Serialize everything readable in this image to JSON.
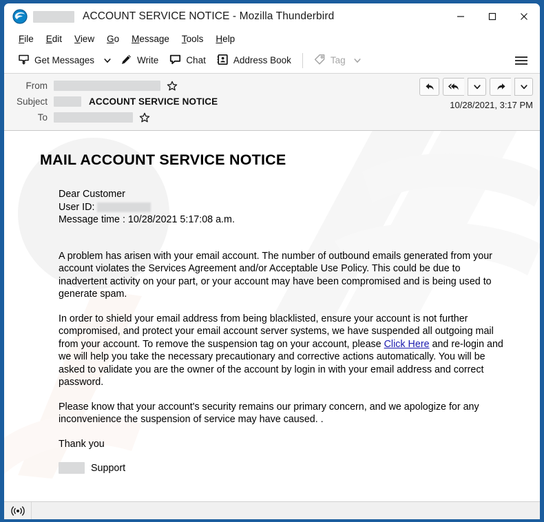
{
  "window": {
    "title": "ACCOUNT SERVICE NOTICE - Mozilla Thunderbird",
    "logo_icon": "thunderbird-logo",
    "minimize_icon": "minimize-icon",
    "maximize_icon": "maximize-icon",
    "close_icon": "close-icon",
    "border_color": "#1b5d9e"
  },
  "menubar": {
    "items": [
      {
        "label": "File",
        "accel": "F",
        "rest": "ile"
      },
      {
        "label": "Edit",
        "accel": "E",
        "rest": "dit"
      },
      {
        "label": "View",
        "accel": "V",
        "rest": "iew"
      },
      {
        "label": "Go",
        "accel": "G",
        "rest": "o"
      },
      {
        "label": "Message",
        "accel": "M",
        "rest": "essage"
      },
      {
        "label": "Tools",
        "accel": "T",
        "rest": "ools"
      },
      {
        "label": "Help",
        "accel": "H",
        "rest": "elp"
      }
    ]
  },
  "toolbar": {
    "get_messages_label": "Get Messages",
    "get_messages_icon": "get-messages-icon",
    "get_messages_caret_icon": "chevron-down-icon",
    "write_label": "Write",
    "write_icon": "pencil-icon",
    "chat_label": "Chat",
    "chat_icon": "speech-bubble-icon",
    "address_book_label": "Address Book",
    "address_book_icon": "address-book-icon",
    "tag_label": "Tag",
    "tag_icon": "tag-icon",
    "tag_caret_icon": "chevron-down-icon",
    "tag_disabled": true,
    "menu_icon": "hamburger-menu-icon"
  },
  "headers": {
    "from_label": "From",
    "from_value": "",
    "from_star_icon": "star-icon",
    "subject_label": "Subject",
    "subject_prefix_redacted": "",
    "subject_value": "ACCOUNT SERVICE NOTICE",
    "to_label": "To",
    "to_value": "",
    "to_star_icon": "star-icon",
    "date": "10/28/2021, 3:17 PM",
    "actions": {
      "reply_icon": "reply-icon",
      "reply_all_icon": "reply-all-icon",
      "reply_all_caret_icon": "chevron-down-icon",
      "forward_icon": "forward-icon",
      "forward_caret_icon": "chevron-down-icon"
    }
  },
  "message": {
    "title": "MAIL ACCOUNT SERVICE NOTICE",
    "greeting": "Dear Customer",
    "user_id_label": "User ID:",
    "user_id_value": "",
    "message_time": "Message time : 10/28/2021 5:17:08 a.m.",
    "paragraph_1": "A problem has arisen with your email account. The number of outbound emails generated from your account violates the  Services Agreement and/or Acceptable Use Policy. This could be due to inadvertent activity on your part, or your account may have been compromised and is being used to generate spam.",
    "paragraph_2_before_link": "In order to shield your email address from being blacklisted, ensure your account is not further compromised, and protect your email account server systems, we have suspended all outgoing mail from your account. To remove the suspension tag on your account, please ",
    "link_text": "Click Here",
    "paragraph_2_after_link": " and re-login and we will help you take the necessary precautionary and corrective actions automatically. You will be asked to validate you are the owner of the account by login in with your email address and correct password.",
    "paragraph_3": "Please know that your account's security remains our primary concern, and we apologize for any inconvenience the suspension of service may have caused. .",
    "thank_you": "Thank you",
    "signature_redacted": "",
    "signature_text": "Support",
    "link_color": "#1a1aae"
  },
  "statusbar": {
    "icon": "broadcast-online-icon"
  }
}
